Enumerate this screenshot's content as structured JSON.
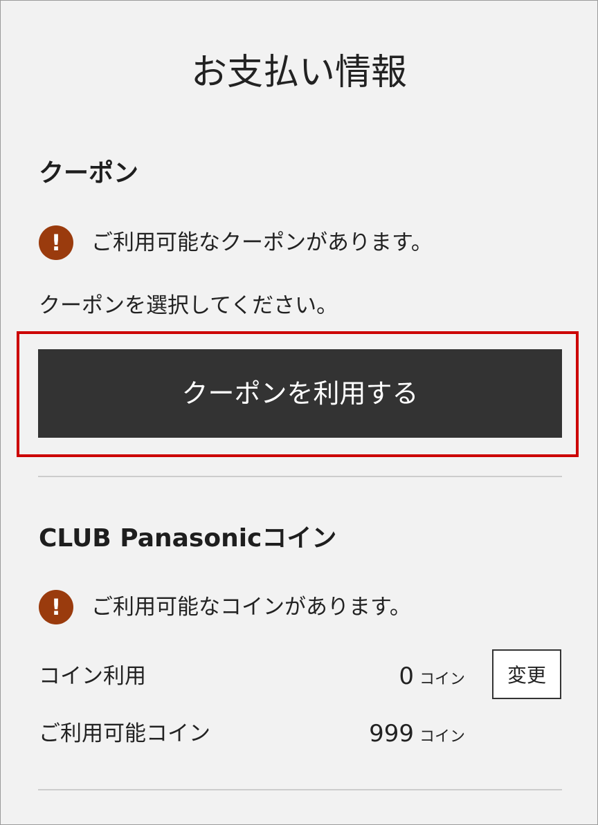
{
  "page": {
    "title": "お支払い情報"
  },
  "coupon": {
    "heading": "クーポン",
    "notice": "ご利用可能なクーポンがあります。",
    "instruction": "クーポンを選択してください。",
    "button_label": "クーポンを利用する"
  },
  "coin": {
    "heading": "CLUB Panasonicコイン",
    "notice": "ご利用可能なコインがあります。",
    "use_label": "コイン利用",
    "use_value": "0",
    "unit": "コイン",
    "change_label": "変更",
    "available_label": "ご利用可能コイン",
    "available_value": "999"
  },
  "icons": {
    "notice_icon_glyph": "!"
  },
  "colors": {
    "background": "#f2f2f2",
    "button_dark": "#333333",
    "alert_icon": "#9a3b0d",
    "highlight_border": "#cc0000"
  }
}
